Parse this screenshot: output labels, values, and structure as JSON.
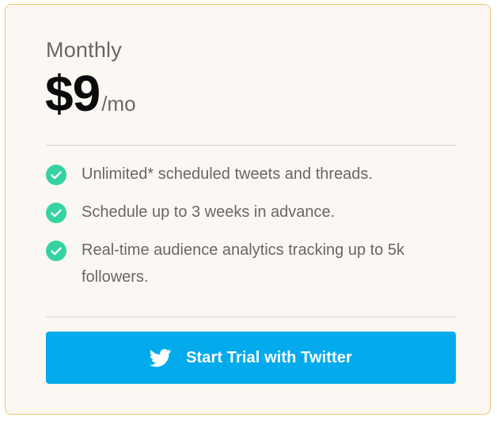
{
  "plan": {
    "name": "Monthly",
    "price": "$9",
    "period": "/mo"
  },
  "features": [
    {
      "text": "Unlimited* scheduled tweets and threads.",
      "icon": "check-circle-icon"
    },
    {
      "text": "Schedule up to 3 weeks in advance.",
      "icon": "check-circle-icon"
    },
    {
      "text": "Real-time audience analytics tracking up to 5k followers.",
      "icon": "check-circle-icon"
    }
  ],
  "cta": {
    "label": "Start Trial with Twitter",
    "icon": "twitter-bird-icon"
  },
  "colors": {
    "card_border": "#f1c86a",
    "card_background": "#fbf8f3",
    "check_green": "#36d3a2",
    "button_blue": "#03abec",
    "text_muted": "#6b6661",
    "text_dark": "#0b0b0b"
  }
}
